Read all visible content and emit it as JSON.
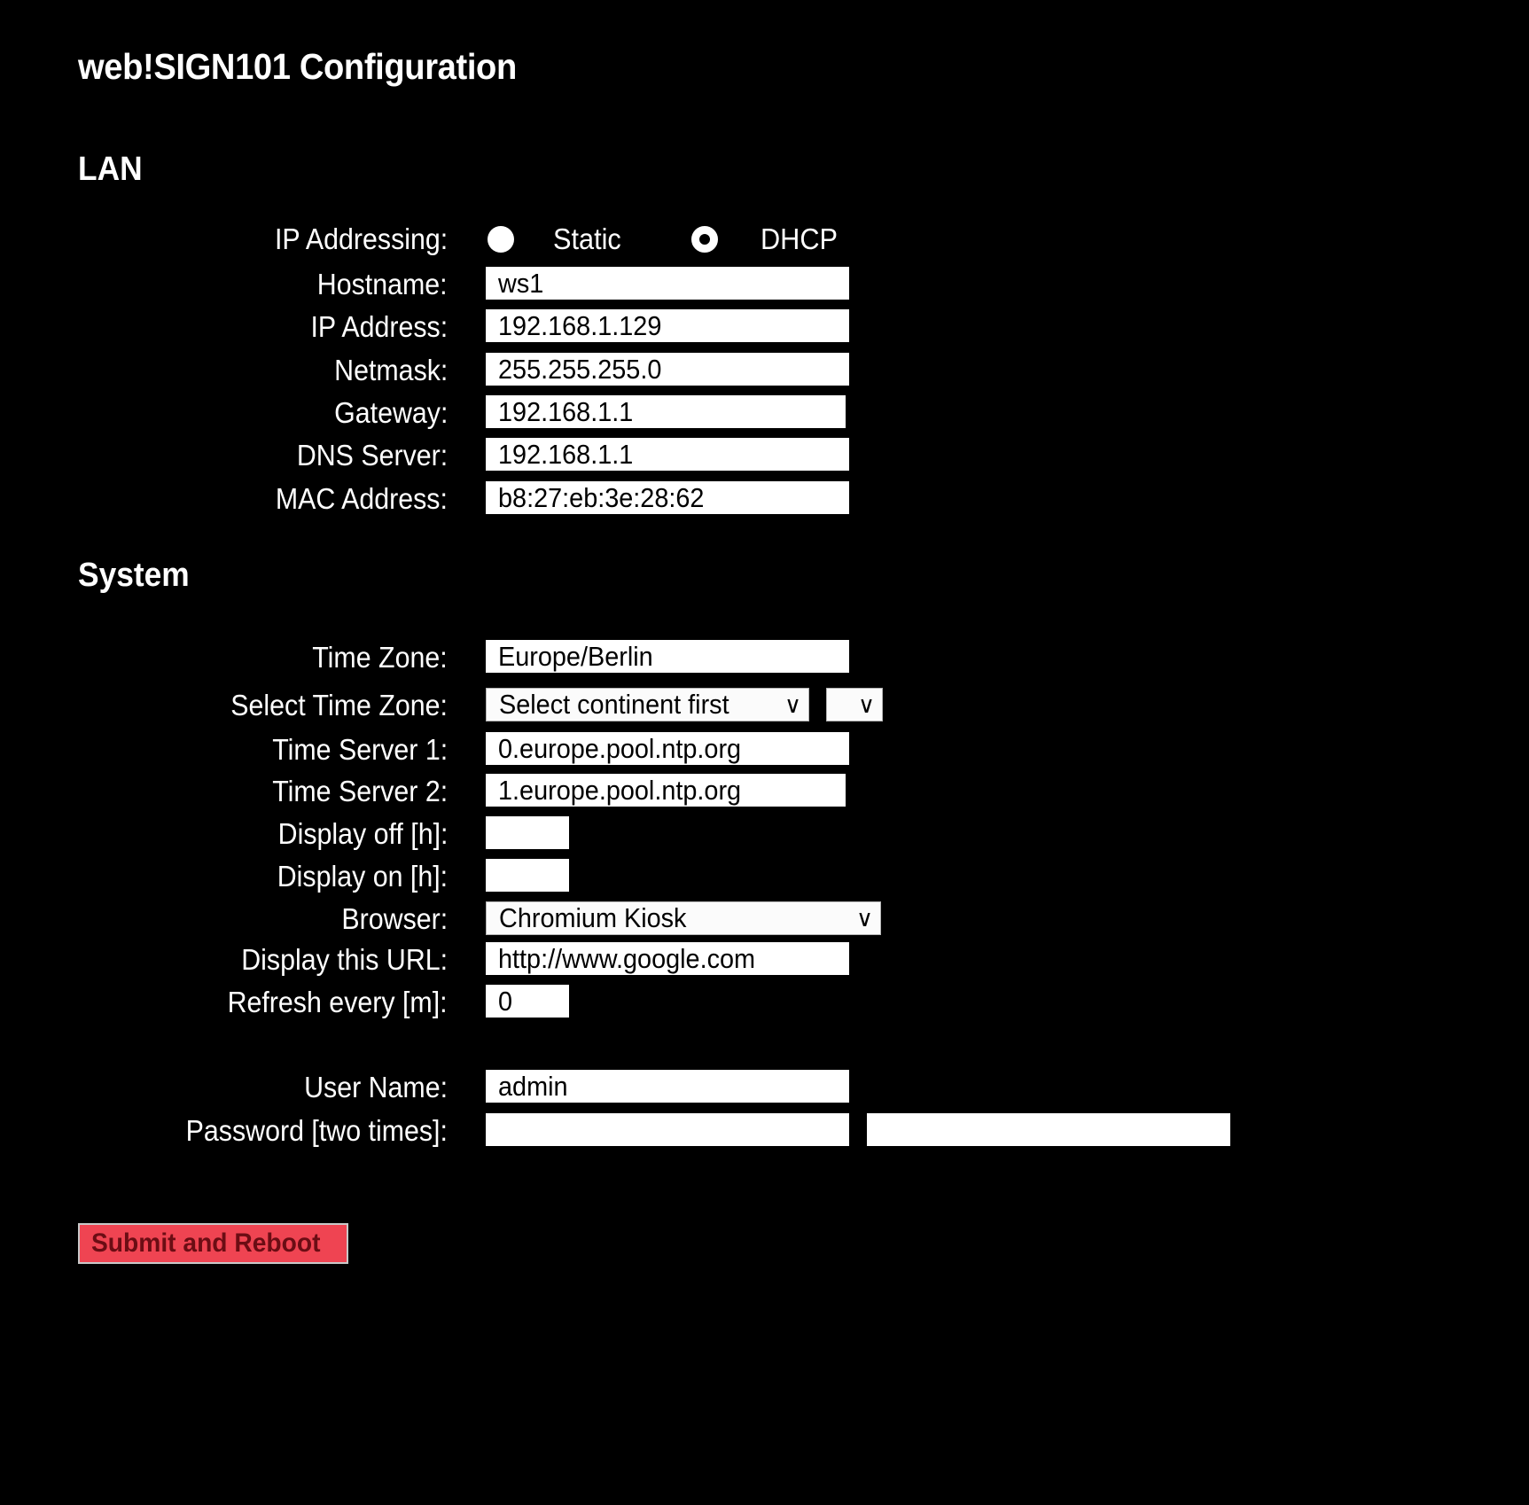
{
  "page": {
    "title": "web!SIGN101 Configuration",
    "background_color": "#000000",
    "text_color": "#ffffff"
  },
  "lan": {
    "heading": "LAN",
    "ip_addressing": {
      "label": "IP Addressing:",
      "options": [
        {
          "label": "Static",
          "selected": false
        },
        {
          "label": "DHCP",
          "selected": true
        }
      ]
    },
    "fields": [
      {
        "label": "Hostname:",
        "value": "ws1"
      },
      {
        "label": "IP Address:",
        "value": "192.168.1.129"
      },
      {
        "label": "Netmask:",
        "value": "255.255.255.0"
      },
      {
        "label": "Gateway:",
        "value": "192.168.1.1"
      },
      {
        "label": "DNS Server:",
        "value": "192.168.1.1"
      },
      {
        "label": "MAC Address:",
        "value": "b8:27:eb:3e:28:62"
      }
    ]
  },
  "system": {
    "heading": "System",
    "time_zone": {
      "label": "Time Zone:",
      "value": "Europe/Berlin"
    },
    "select_time_zone": {
      "label": "Select Time Zone:",
      "continent_value": "Select continent first",
      "city_value": "",
      "chevron": "∨"
    },
    "time_server_1": {
      "label": "Time Server 1:",
      "value": "0.europe.pool.ntp.org"
    },
    "time_server_2": {
      "label": "Time Server 2:",
      "value": "1.europe.pool.ntp.org"
    },
    "display_off": {
      "label": "Display off [h]:",
      "value": ""
    },
    "display_on": {
      "label": "Display on [h]:",
      "value": ""
    },
    "browser": {
      "label": "Browser:",
      "value": "Chromium Kiosk",
      "chevron": "∨"
    },
    "display_url": {
      "label": "Display this URL:",
      "value": "http://www.google.com"
    },
    "refresh": {
      "label": "Refresh every [m]:",
      "value": "0"
    }
  },
  "credentials": {
    "user_name": {
      "label": "User Name:",
      "value": "admin"
    },
    "password": {
      "label": "Password [two times]:",
      "value_1": "",
      "value_2": ""
    }
  },
  "submit": {
    "label": "Submit and Reboot",
    "background_color": "#ef4452",
    "text_color": "#6b0d14",
    "border_color": "#c9c9c9"
  }
}
